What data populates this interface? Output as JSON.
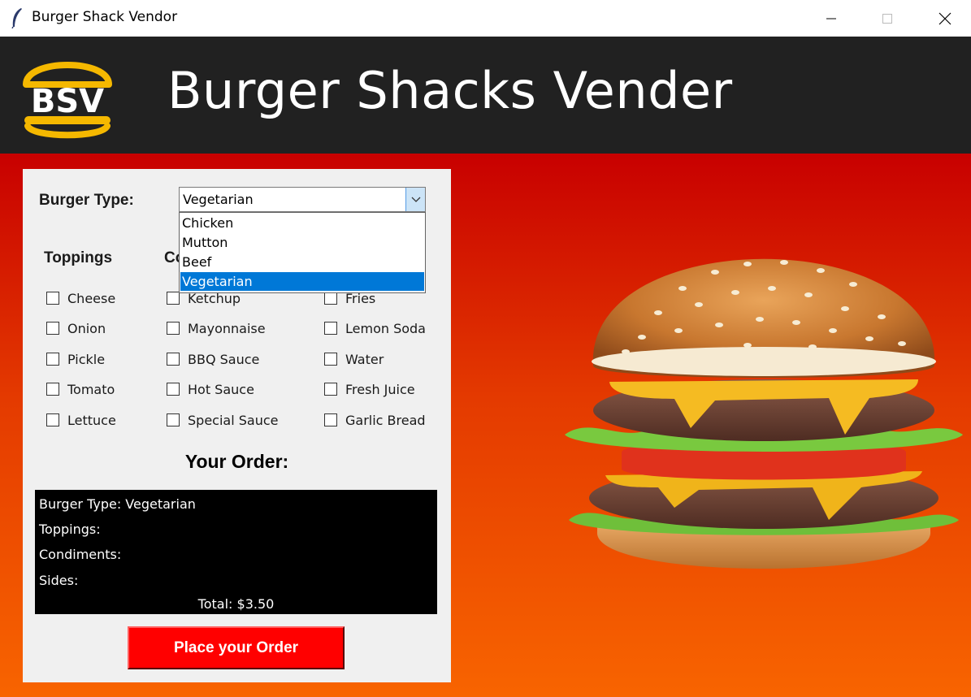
{
  "window": {
    "title": "Burger Shack Vendor"
  },
  "header": {
    "logo_text": "BSV",
    "title": "Burger Shacks Vender"
  },
  "form": {
    "burger_type_label": "Burger Type:",
    "burger_type_value": "Vegetarian",
    "burger_type_options": [
      "Chicken",
      "Mutton",
      "Beef",
      "Vegetarian"
    ],
    "toppings_label": "Toppings",
    "condiments_label_visible": "Co",
    "toppings": [
      "Cheese",
      "Onion",
      "Pickle",
      "Tomato",
      "Lettuce"
    ],
    "condiments": [
      "Ketchup",
      "Mayonnaise",
      "BBQ Sauce",
      "Hot Sauce",
      "Special Sauce"
    ],
    "sides": [
      "Fries",
      "Lemon Soda",
      "Water",
      "Fresh Juice",
      "Garlic Bread"
    ]
  },
  "order": {
    "heading": "Your Order:",
    "burger_type_line": "Burger Type: Vegetarian",
    "toppings_line": "Toppings:",
    "condiments_line": "Condiments:",
    "sides_line": "Sides:",
    "total_line": "Total: $3.50"
  },
  "place_order_label": "Place your Order",
  "colors": {
    "header_bg": "#212121",
    "logo_yellow": "#f5b800",
    "button_red": "#ff0000",
    "selection_blue": "#0078d7"
  },
  "icons": [
    "feather-icon",
    "minimize-icon",
    "maximize-icon",
    "close-icon",
    "chevron-down-icon"
  ]
}
